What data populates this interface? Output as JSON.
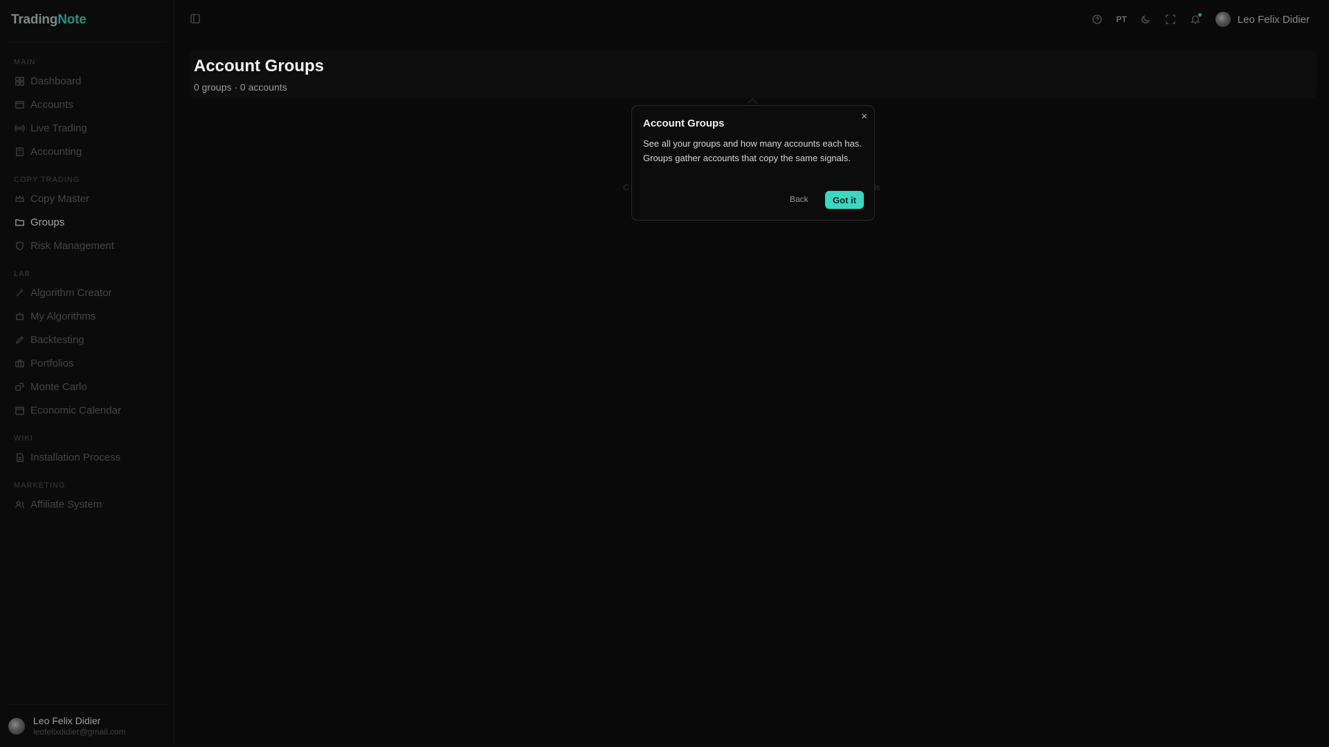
{
  "brand": {
    "part1": "Trading",
    "part2": "Note"
  },
  "sidebar": {
    "sections": {
      "main": "MAIN",
      "copy_trading": "COPY TRADING",
      "lab": "LAB",
      "wiki": "WIKI",
      "marketing": "MARKETING"
    },
    "items": {
      "dashboard": "Dashboard",
      "accounts": "Accounts",
      "live_trading": "Live Trading",
      "accounting": "Accounting",
      "copy_master": "Copy Master",
      "groups": "Groups",
      "risk_management": "Risk Management",
      "algorithm_creator": "Algorithm Creator",
      "my_algorithms": "My Algorithms",
      "backtesting": "Backtesting",
      "portfolios": "Portfolios",
      "monte_carlo": "Monte Carlo",
      "economic_calendar": "Economic Calendar",
      "installation_process": "Installation Process",
      "affiliate_system": "Affiliate System"
    },
    "active_item": "groups",
    "user": {
      "name": "Leo Felix Didier",
      "email": "leofelixdidier@gmail.com"
    }
  },
  "topbar": {
    "language": "PT",
    "user_name": "Leo Felix Didier",
    "icons": [
      "help-icon",
      "moon-icon",
      "fullscreen-icon",
      "bell-icon"
    ]
  },
  "page": {
    "title": "Account Groups",
    "subtitle": "0 groups · 0 accounts",
    "empty_left": "C",
    "empty_right": "ls"
  },
  "popover": {
    "title": "Account Groups",
    "body": "See all your groups and how many accounts each has. Groups gather accounts that copy the same signals.",
    "close": "×",
    "back_label": "Back",
    "ok_label": "Got it"
  },
  "colors": {
    "accent": "#3ed6c0",
    "brand_note": "#2f8f7e",
    "background": "#0a0a0a"
  }
}
